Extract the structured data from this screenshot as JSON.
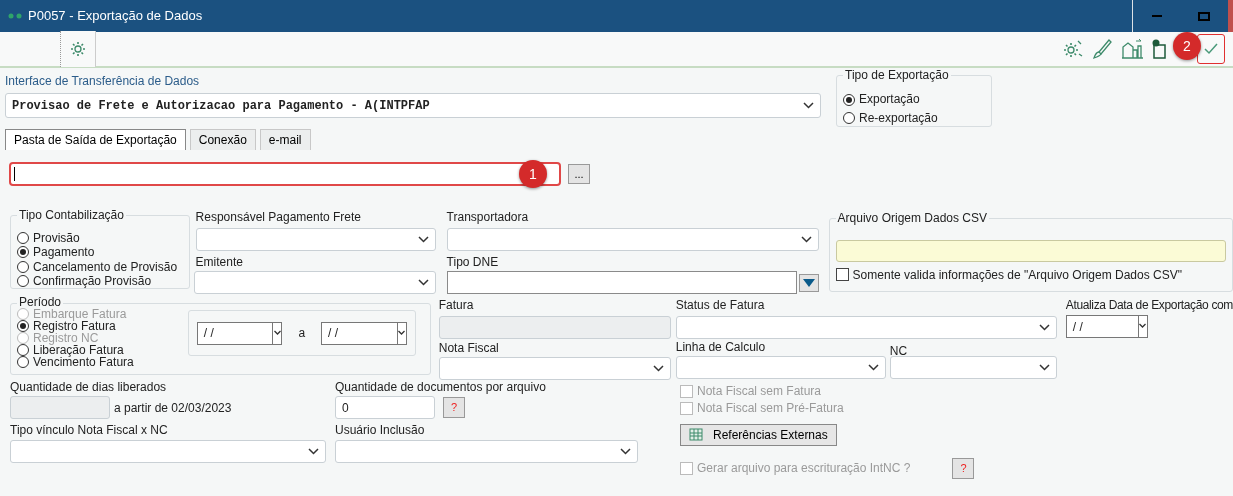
{
  "window": {
    "title": "P0057 - Exportação de Dados"
  },
  "toolbar": {
    "callout": "2"
  },
  "interface": {
    "label": "Interface de Transferência de Dados",
    "value": "Provisao de Frete e Autorizacao para Pagamento - A(INTPFAP"
  },
  "export_type": {
    "label": "Tipo de Exportação",
    "options": [
      {
        "label": "Exportação",
        "selected": true
      },
      {
        "label": "Re-exportação",
        "selected": false
      }
    ]
  },
  "tabs": [
    {
      "label": "Pasta de Saída de Exportação",
      "selected": true
    },
    {
      "label": "Conexão",
      "selected": false
    },
    {
      "label": "e-mail",
      "selected": false
    }
  ],
  "output_folder": {
    "browse_button": "...",
    "callout": "1"
  },
  "accounting_type": {
    "label": "Tipo Contabilização",
    "options": [
      {
        "label": "Provisão",
        "selected": false
      },
      {
        "label": "Pagamento",
        "selected": true
      },
      {
        "label": "Cancelamento de Provisão",
        "selected": false
      },
      {
        "label": "Confirmação Provisão",
        "selected": false
      }
    ]
  },
  "freight_payer": {
    "label": "Responsável Pagamento Frete"
  },
  "issuer": {
    "label": "Emitente"
  },
  "carrier": {
    "label": "Transportadora"
  },
  "dne_type": {
    "label": "Tipo DNE"
  },
  "csv_source": {
    "label": "Arquivo Origem Dados CSV",
    "checkbox": {
      "label": "Somente valida informações de \"Arquivo Origem Dados CSV\"",
      "checked": false
    }
  },
  "period": {
    "label": "Período",
    "options": [
      {
        "label": "Embarque Fatura",
        "selected": false,
        "disabled": true
      },
      {
        "label": "Registro Fatura",
        "selected": true,
        "disabled": false
      },
      {
        "label": "Registro NC",
        "selected": false,
        "disabled": true
      },
      {
        "label": "Liberação Fatura",
        "selected": false,
        "disabled": false
      },
      {
        "label": "Vencimento Fatura",
        "selected": false,
        "disabled": false
      }
    ],
    "from": "/ /",
    "separator": "a",
    "to": "/ /"
  },
  "invoice": {
    "label": "Fatura"
  },
  "invoice_status": {
    "label": "Status de Fatura"
  },
  "export_date_update": {
    "label": "Atualiza Data de Exportação com",
    "value": "/ /"
  },
  "fiscal_note": {
    "label": "Nota Fiscal"
  },
  "calc_line": {
    "label": "Linha de Calculo"
  },
  "nc": {
    "label": "NC"
  },
  "released_days": {
    "label": "Quantidade de dias liberados",
    "suffix": "a partir de 02/03/2023"
  },
  "docs_per_file": {
    "label": "Quantidade de documentos por arquivo",
    "value": "0",
    "help": "?"
  },
  "options": [
    {
      "label": "Nota Fiscal sem Fatura",
      "checked": false,
      "disabled": true
    },
    {
      "label": "Nota Fiscal sem Pré-Fatura",
      "checked": false,
      "disabled": true
    }
  ],
  "link_type": {
    "label": "Tipo vínculo Nota Fiscal x NC"
  },
  "created_by": {
    "label": "Usuário Inclusão"
  },
  "external_refs_button": "Referências Externas",
  "generate_intnc": {
    "label": "Gerar arquivo para escrituração IntNC ?",
    "checked": false,
    "disabled": true,
    "help": "?"
  }
}
